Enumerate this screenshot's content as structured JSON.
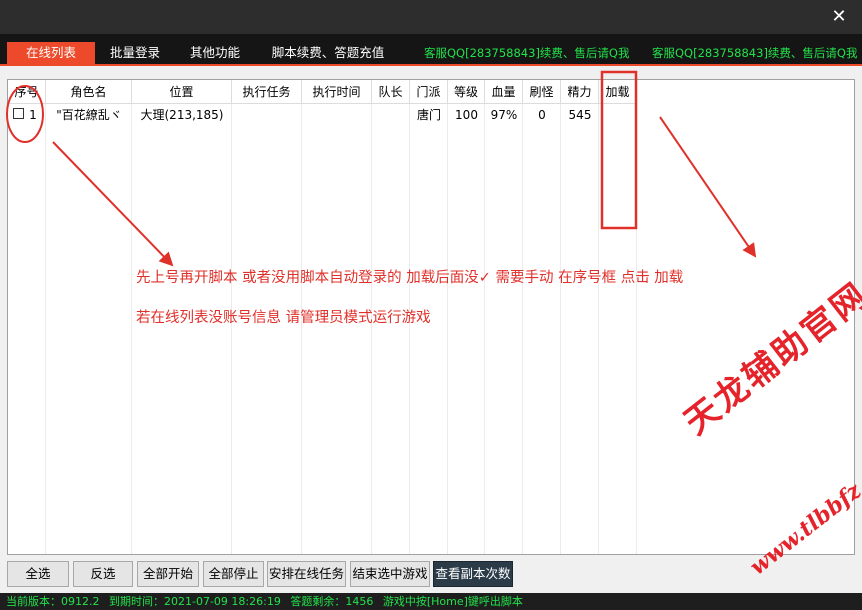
{
  "window": {
    "close_glyph": "✕"
  },
  "tabs": [
    {
      "label": "在线列表",
      "active": true
    },
    {
      "label": "批量登录"
    },
    {
      "label": "其他功能"
    },
    {
      "label": "脚本续费、答题充值"
    }
  ],
  "service_notes": [
    "客服QQ[283758843]续费、售后请Q我",
    "客服QQ[283758843]续费、售后请Q我"
  ],
  "table": {
    "columns": [
      "序号",
      "角色名",
      "位置",
      "执行任务",
      "执行时间",
      "队长",
      "门派",
      "等级",
      "血量",
      "刷怪",
      "精力",
      "加载"
    ],
    "rows": [
      {
        "index": "1",
        "name": "\"百花繚乱ヾ",
        "location": "大理(213,185)",
        "task": "",
        "time": "",
        "leader": "",
        "sect": "唐门",
        "level": "100",
        "hp": "97%",
        "kills": "0",
        "energy": "545",
        "loaded": ""
      }
    ]
  },
  "annotations": {
    "line1": "先上号再开脚本 或者没用脚本自动登录的   加载后面没✓ 需要手动 在序号框 点击 加载",
    "line2": "若在线列表没账号信息 请管理员模式运行游戏"
  },
  "buttons": [
    "全选",
    "反选",
    "全部开始",
    "全部停止",
    "安排在线任务",
    "结束选中游戏",
    "查看副本次数"
  ],
  "status": {
    "version": "当前版本：0912.2",
    "expiry": "到期时间：2021-07-09 18:26:19",
    "remaining": "答题剩余：1456",
    "hint": "游戏中按[Home]键呼出脚本"
  },
  "watermark": {
    "text_cn": "天龙辅助官网",
    "text_url": "www.tlbbfz.com"
  },
  "colors": {
    "accent": "#ec4a2a",
    "status_green": "#22e24a",
    "annotation_red": "#e0302a"
  }
}
